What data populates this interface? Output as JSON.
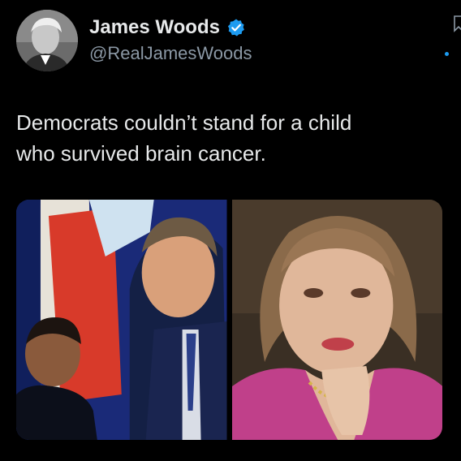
{
  "author": {
    "display_name": "James Woods",
    "handle": "@RealJamesWoods",
    "verified": true,
    "avatar_icon": "grayscale-portrait"
  },
  "tweet": {
    "text": "Democrats couldn’t stand for a child\nwho survived brain cancer."
  },
  "media": {
    "images": [
      {
        "name": "man-with-boy-photo"
      },
      {
        "name": "woman-in-pink-photo"
      }
    ]
  },
  "colors": {
    "background": "#000000",
    "text_primary": "#e7e9ea",
    "text_secondary": "#8b98a5",
    "accent_blue": "#1d9bf0"
  },
  "icons": [
    "verified-badge-icon",
    "bookmark-icon",
    "dot-icon"
  ]
}
